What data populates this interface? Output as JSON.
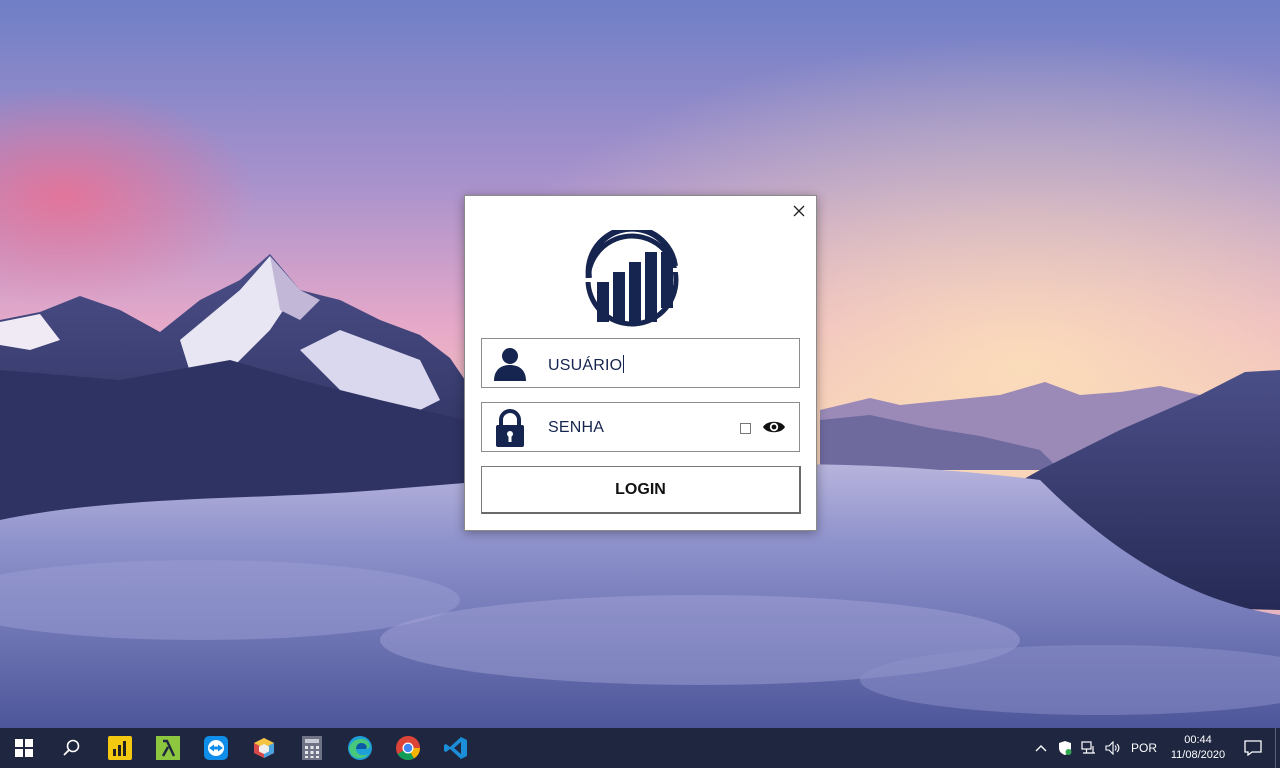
{
  "desktop": {
    "wallpaper": "mountain-sunset-clouds"
  },
  "login": {
    "username_value": "USUÁRIO",
    "password_value": "SENHA",
    "login_label": "LOGIN",
    "accent_color": "#16254f"
  },
  "taskbar": {
    "pinned": [
      {
        "name": "power-bi-icon"
      },
      {
        "name": "lambda-app-icon"
      },
      {
        "name": "teamviewer-icon"
      },
      {
        "name": "box-app-icon"
      },
      {
        "name": "calculator-icon"
      },
      {
        "name": "edge-icon"
      },
      {
        "name": "chrome-icon"
      },
      {
        "name": "vscode-icon"
      }
    ],
    "tray": {
      "language": "POR",
      "time": "00:44",
      "date": "11/08/2020"
    }
  }
}
